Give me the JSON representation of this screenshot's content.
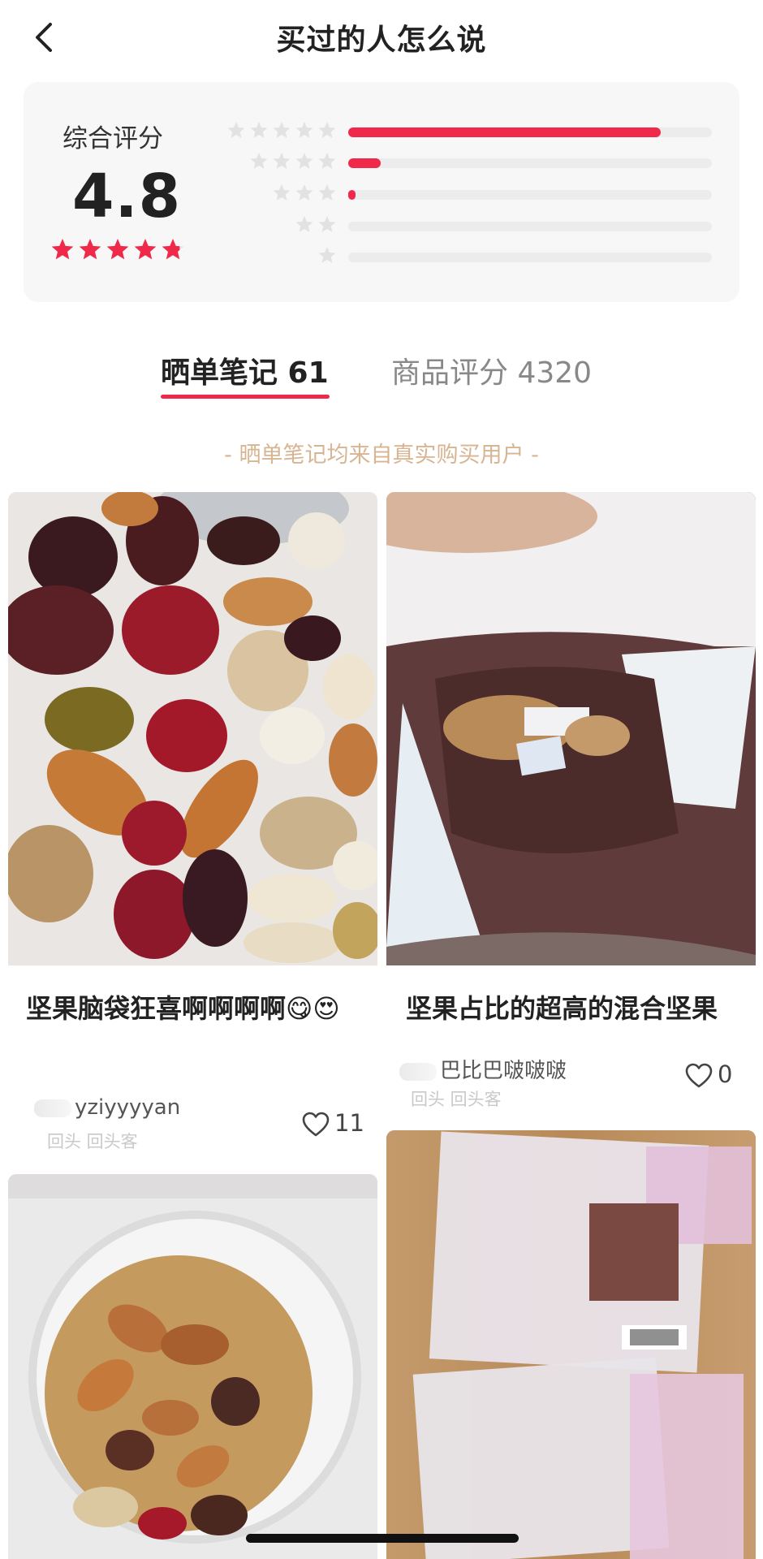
{
  "header": {
    "title": "买过的人怎么说",
    "back_icon": "chevron-left-icon"
  },
  "rating": {
    "label": "综合评分",
    "score": "4.8",
    "star_color": "#f0294a",
    "overall_stars_filled": 4.8,
    "distribution": [
      {
        "stars": 5,
        "share": 0.86
      },
      {
        "stars": 4,
        "share": 0.09
      },
      {
        "stars": 3,
        "share": 0.02
      },
      {
        "stars": 2,
        "share": 0
      },
      {
        "stars": 1,
        "share": 0
      }
    ]
  },
  "tabs": {
    "notes": "晒单笔记 61",
    "reviews": "商品评分 4320",
    "active": "notes"
  },
  "notice": "- 晒单笔记均来自真实购买用户 -",
  "cards": [
    {
      "title": "坚果脑袋狂喜啊啊啊啊😋😍",
      "user": "yziyyyyan",
      "sub": "回头  回头客",
      "likes": "11",
      "image": "mixed-nuts-closeup-photo"
    },
    {
      "title": "坚果占比的超高的混合坚果",
      "user": "巴比巴啵啵啵",
      "sub": "回头  回头客",
      "likes": "0",
      "image": "nuts-in-container-photo"
    },
    {
      "title": "",
      "image": "nuts-in-glass-jar-photo"
    },
    {
      "title": "",
      "image": "nut-packets-photo"
    }
  ],
  "colors": {
    "accent": "#f0294a",
    "notice": "#d8b592",
    "card_bg": "#f7f7f7"
  }
}
